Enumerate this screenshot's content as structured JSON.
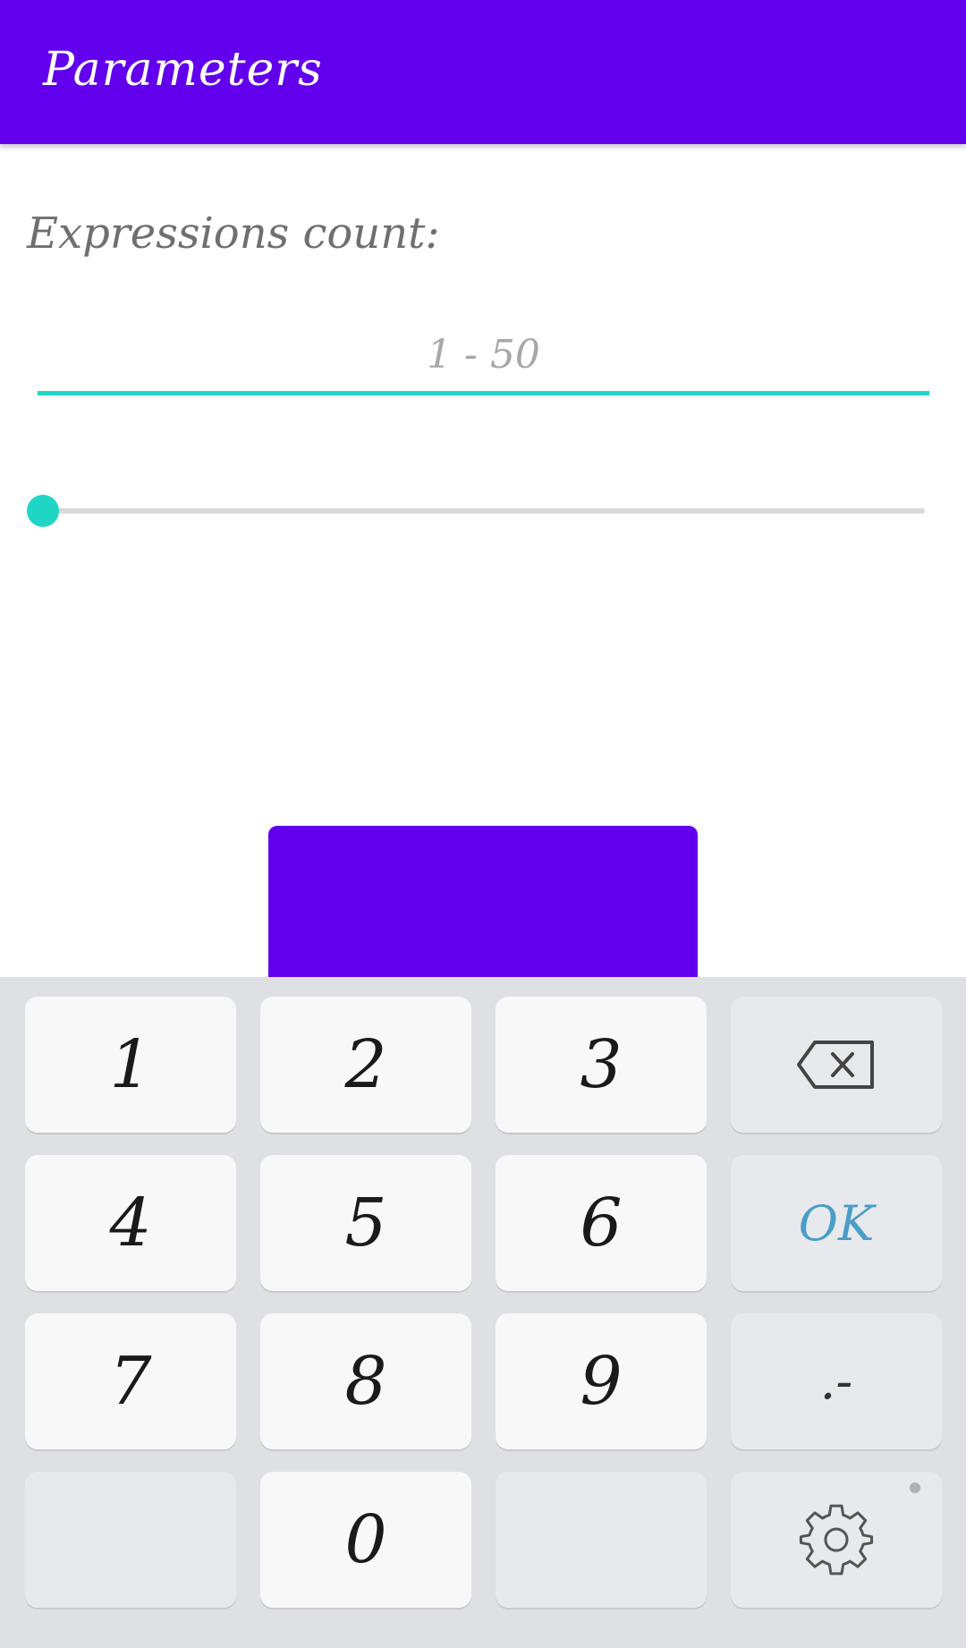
{
  "app_bar": {
    "title": "Parameters",
    "color": "#6200EE"
  },
  "form": {
    "label": "Expressions count:",
    "input": {
      "value": "",
      "placeholder": "1 - 50"
    },
    "slider": {
      "min": 1,
      "max": 50,
      "value": 1,
      "accent": "#1FD6C4"
    },
    "primary_button": {
      "label": ""
    }
  },
  "keyboard": {
    "keys": {
      "k1": "1",
      "k2": "2",
      "k3": "3",
      "k4": "4",
      "k5": "5",
      "k6": "6",
      "k7": "7",
      "k8": "8",
      "k9": "9",
      "k0": "0",
      "ok": "OK",
      "punct": ".-"
    },
    "icons": {
      "backspace": "backspace-icon",
      "settings": "gear-icon"
    }
  }
}
